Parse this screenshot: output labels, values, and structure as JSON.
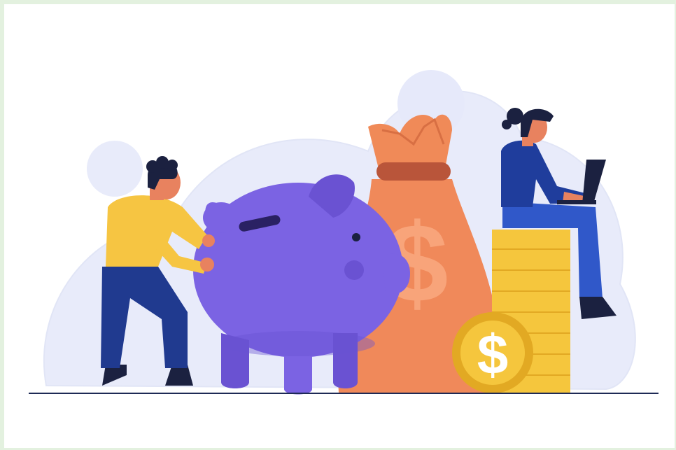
{
  "scene": {
    "description_free": true,
    "symbols": {
      "bag_symbol": "$",
      "coin_symbol": "$"
    },
    "colors": {
      "background_frame": "#e3f1df",
      "canvas": "#ffffff",
      "backdrop_blob": "#e8ebfa",
      "piggy": "#7b63e3",
      "piggy_shade": "#6a52d2",
      "money_bag": "#f0895a",
      "money_bag_band": "#b9553a",
      "coin": "#f5c63d",
      "coin_rim": "#e2a923",
      "man_shirt": "#f6c542",
      "man_pants": "#203a8f",
      "woman_top": "#1f3d9c",
      "woman_pants": "#3058c9",
      "hair": "#1b2140",
      "skin": "#e8825f",
      "ground_line": "#1e2a55"
    }
  }
}
